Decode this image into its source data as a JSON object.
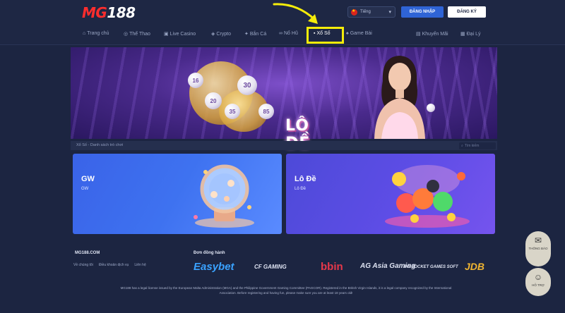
{
  "header": {
    "logo_prefix": "MG",
    "logo_suffix": "188",
    "language": "Tiếng",
    "login_label": "ĐĂNG NHẬP",
    "register_label": "ĐĂNG KÝ"
  },
  "nav": {
    "items": [
      {
        "label": "Trang chủ",
        "icon": "home-icon"
      },
      {
        "label": "Thể Thao",
        "icon": "sports-icon"
      },
      {
        "label": "Live Casino",
        "icon": "casino-icon"
      },
      {
        "label": "Crypto",
        "icon": "crypto-icon"
      },
      {
        "label": "Bắn Cá",
        "icon": "fish-icon"
      },
      {
        "label": "Nổ Hũ",
        "icon": "slot-icon"
      },
      {
        "label": "Xổ Số",
        "icon": "lottery-icon"
      },
      {
        "label": "Game Bài",
        "icon": "cards-icon"
      },
      {
        "label": "Khuyến Mãi",
        "icon": "gift-icon"
      },
      {
        "label": "Đại Lý",
        "icon": "agent-icon"
      }
    ],
    "active_index": 6,
    "highlight_color": "#f5ec0a"
  },
  "banner": {
    "title": "LÔ ĐỀ",
    "ball_numbers": [
      "16",
      "30",
      "20",
      "35",
      "85"
    ]
  },
  "subbar": {
    "breadcrumb": "Xổ Số - Danh sách trò chơi",
    "search_placeholder": "Tìm kiếm"
  },
  "cards": [
    {
      "title": "GW",
      "subtitle": "GW"
    },
    {
      "title": "Lô Đề",
      "subtitle": "Lô Đề"
    }
  ],
  "footer": {
    "brand": "MG188.COM",
    "links": [
      "Về chúng tôi",
      "Điều khoản dịch vụ",
      "Liên hệ"
    ],
    "partner_title": "Đơn đồng hành",
    "partners": [
      "Easybet",
      "CF GAMING",
      "bbin",
      "AG Asia Gaming",
      "PG POCKET GAMES SOFT",
      "JDB"
    ],
    "legal": "MG188 has a legal license issued by the European Malta Administration (MGA) and the Philippine Government Gaming Committee (PAGCOR). Registered in the British Virgin Islands, it is a legal company recognized by the International Association. Before registering and having fun, please make sure you are at least 18 years old!"
  },
  "widgets": {
    "support_label": "THÔNG BÁO",
    "hotline_label": "HỖ TRỢ"
  },
  "colors": {
    "bg": "#1c2541",
    "login": "#2f64d6",
    "logo_red": "#ff2d2d",
    "card_gw": "#3e72f0",
    "card_lo": "#5e4de6"
  }
}
